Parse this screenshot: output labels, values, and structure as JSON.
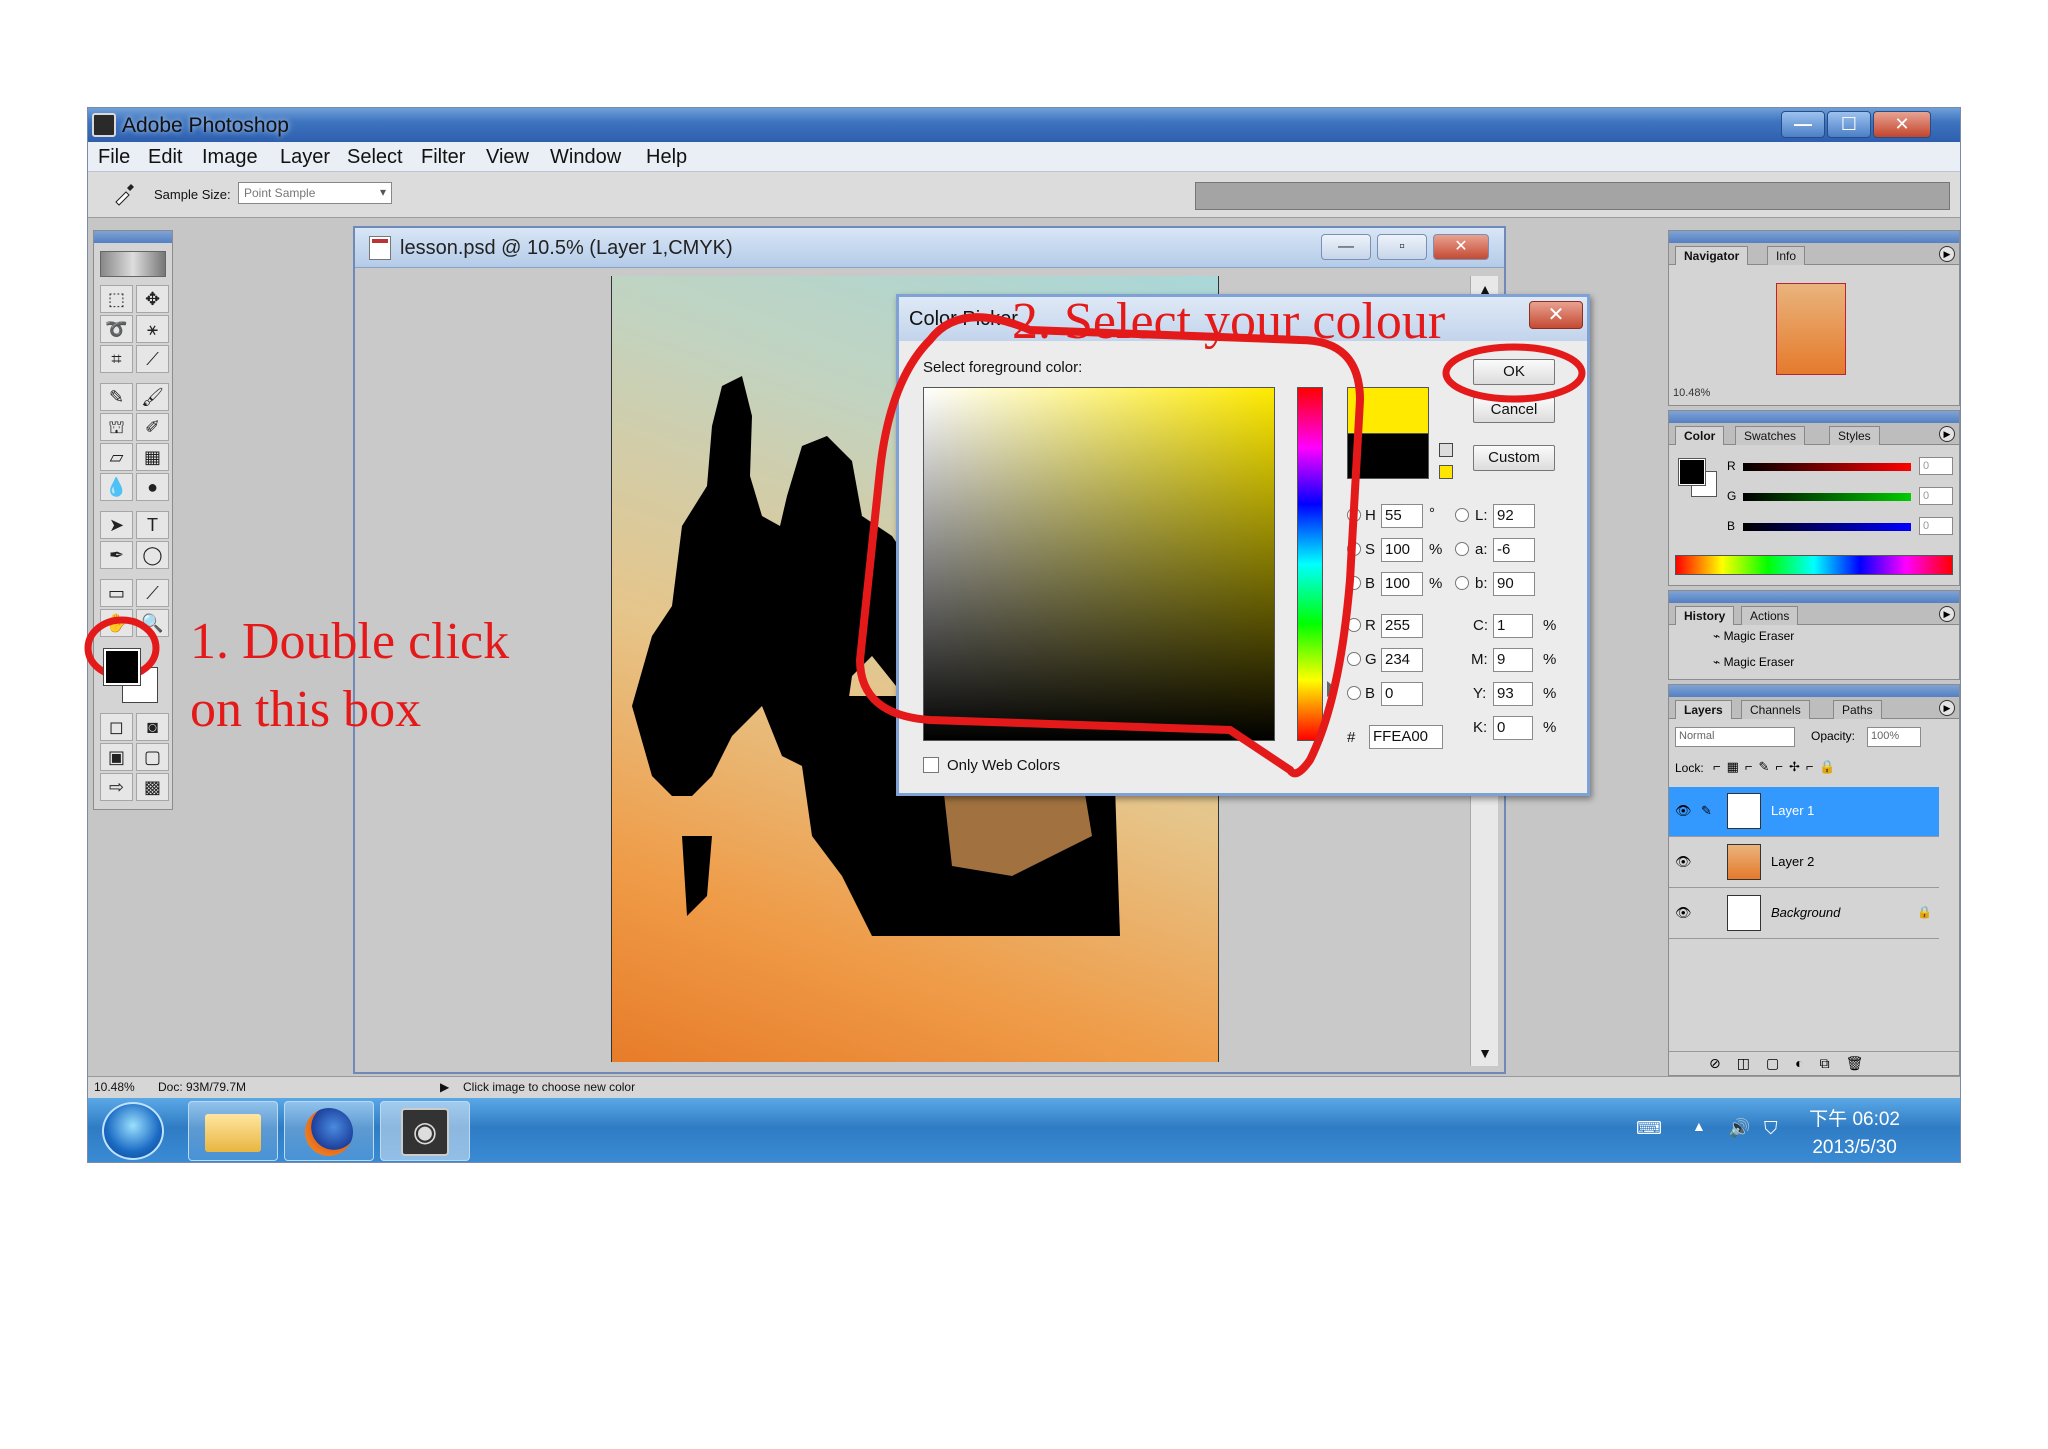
{
  "window": {
    "title": "Adobe Photoshop",
    "min": "—",
    "max": "☐",
    "close": "✕"
  },
  "menu": [
    "File",
    "Edit",
    "Image",
    "Layer",
    "Select",
    "Filter",
    "View",
    "Window",
    "Help"
  ],
  "options_bar": {
    "sample_size_label": "Sample Size:",
    "sample_size_value": "Point Sample"
  },
  "document": {
    "title": "lesson.psd @ 10.5% (Layer 1,CMYK)"
  },
  "color_picker": {
    "title": "Color Picker",
    "prompt": "Select foreground color:",
    "ok": "OK",
    "cancel": "Cancel",
    "custom": "Custom",
    "only_web_colors": "Only Web Colors",
    "new_color": "#ffea00",
    "current_color": "#000000",
    "hsb": {
      "H": "55",
      "S": "100",
      "B": "100"
    },
    "rgb": {
      "R": "255",
      "G": "234",
      "B": "0"
    },
    "lab": {
      "L": "92",
      "a": "-6",
      "b": "90"
    },
    "cmyk": {
      "C": "1",
      "M": "9",
      "Y": "93",
      "K": "0"
    },
    "hex_label": "#",
    "hex": "FFEA00",
    "deg": "°",
    "pct": "%"
  },
  "navigator": {
    "tabs": [
      "Navigator",
      "Info"
    ],
    "zoom": "10.48%"
  },
  "color_palette": {
    "tabs": [
      "Color",
      "Swatches",
      "Styles"
    ],
    "sliders": [
      {
        "label": "R",
        "value": "0"
      },
      {
        "label": "G",
        "value": "0"
      },
      {
        "label": "B",
        "value": "0"
      }
    ]
  },
  "history": {
    "tabs": [
      "History",
      "Actions"
    ],
    "items": [
      "Magic Eraser",
      "Magic Eraser"
    ]
  },
  "layers": {
    "tabs": [
      "Layers",
      "Channels",
      "Paths"
    ],
    "blend_mode": "Normal",
    "opacity_label": "Opacity:",
    "opacity": "100%",
    "lock_label": "Lock:",
    "items": [
      {
        "name": "Layer 1",
        "selected": true
      },
      {
        "name": "Layer 2",
        "selected": false
      },
      {
        "name": "Background",
        "selected": false
      }
    ]
  },
  "status_bar": {
    "zoom": "10.48%",
    "doc": "Doc: 93M/79.7M",
    "hint": "Click image to choose new color"
  },
  "taskbar": {
    "time": "下午 06:02",
    "date": "2013/5/30"
  },
  "annotations": {
    "step1_line1": "1. Double click",
    "step1_line2": "on this box",
    "step2": "2. Select your colour"
  },
  "colors": {
    "annotation": "#e41a1a",
    "selection": "#3399ff"
  }
}
